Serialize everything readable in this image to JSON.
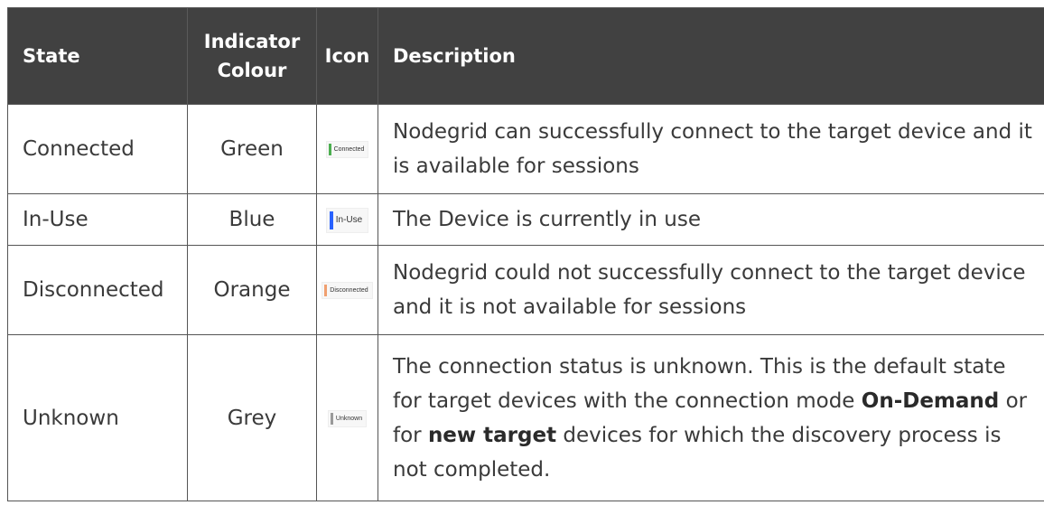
{
  "headers": {
    "state": "State",
    "indicator_line1": "Indicator",
    "indicator_line2": "Colour",
    "icon": "Icon",
    "description": "Description"
  },
  "rows": [
    {
      "state": "Connected",
      "colour": "Green",
      "icon_label": "Connected",
      "icon_color": "#4caf50",
      "description": "Nodegrid can successfully connect to the target device and it is available for sessions"
    },
    {
      "state": "In-Use",
      "colour": "Blue",
      "icon_label": "In-Use",
      "icon_color": "#2962ff",
      "description": "The Device is currently in use"
    },
    {
      "state": "Disconnected",
      "colour": "Orange",
      "icon_label": "Disconnected",
      "icon_color": "#f0a070",
      "description": "Nodegrid could not successfully connect to the target device and it is not available for sessions"
    },
    {
      "state": "Unknown",
      "colour": "Grey",
      "icon_label": "Unknown",
      "icon_color": "#999999",
      "description_part1": "The connection status is unknown. This is the default state for target devices with the connection mode ",
      "description_bold1": "On-Demand",
      "description_part2": " or for ",
      "description_bold2": "new target",
      "description_part3": " devices for which the discovery process is not completed."
    }
  ]
}
